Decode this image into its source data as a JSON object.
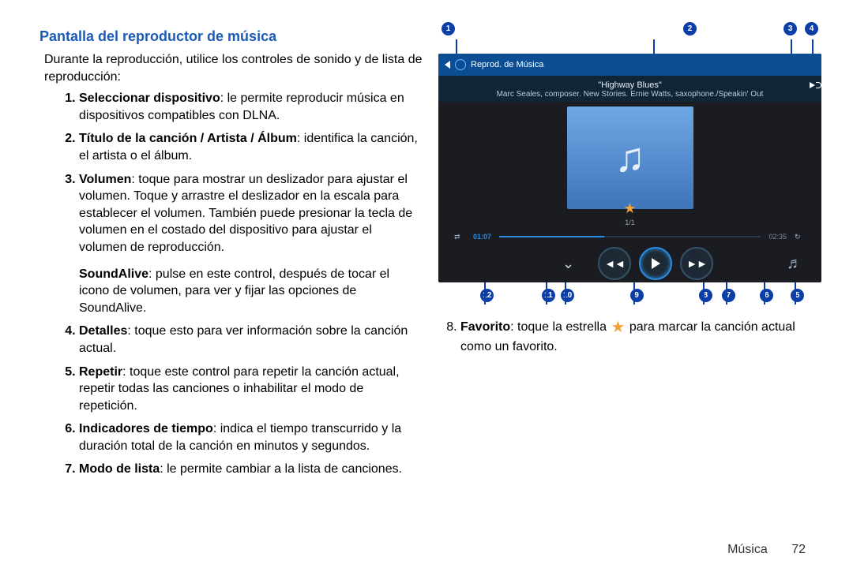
{
  "section_title": "Pantalla del reproductor de música",
  "intro": "Durante la reproducción, utilice los controles de sonido y de lista de reproducción:",
  "items": [
    {
      "lead": "Seleccionar dispositivo",
      "rest": ": le permite reproducir música en dispositivos compatibles con DLNA."
    },
    {
      "lead": "Título de la canción / Artista / Álbum",
      "rest": ": identifica la canción, el artista o el álbum."
    },
    {
      "lead": "Volumen",
      "rest": ": toque para mostrar un deslizador para ajustar el volumen. Toque y arrastre el deslizador en la escala para establecer el volumen. También puede presionar la tecla de volumen en el costado del dispositivo para ajustar el volumen de reproducción."
    },
    {
      "lead": "SoundAlive",
      "rest": ": pulse en este control, después de tocar el icono de volumen, para ver y fijar las opciones de SoundAlive.",
      "unnumbered": true
    },
    {
      "lead": "Detalles",
      "rest": ": toque esto para ver información sobre la canción actual."
    },
    {
      "lead": "Repetir",
      "rest": ": toque este control para repetir la canción actual, repetir todas las canciones o inhabilitar el modo de repetición."
    },
    {
      "lead": "Indicadores de tiempo",
      "rest": ": indica el tiempo transcurrido y la duración total de la canción en minutos y segundos."
    },
    {
      "lead": "Modo de lista",
      "rest": ": le permite cambiar a la lista de canciones."
    }
  ],
  "item8": {
    "lead": "Favorito",
    "pre": ": toque la estrella ",
    "post": " para marcar la canción actual como un favorito."
  },
  "player": {
    "bar_title": "Reprod. de Música",
    "song": "\"Highway Blues\"",
    "artist": "Marc Seales, composer. New Stories. Ernie Watts, saxophone./Speakin' Out",
    "counter": "1/1",
    "elapsed": "01:07",
    "total": "02:35"
  },
  "callouts_top": [
    "1",
    "2",
    "3",
    "4"
  ],
  "callouts_bottom_order": [
    "12",
    "11",
    "10",
    "9",
    "8",
    "7",
    "6",
    "5"
  ],
  "footer": {
    "label": "Música",
    "page": "72"
  }
}
